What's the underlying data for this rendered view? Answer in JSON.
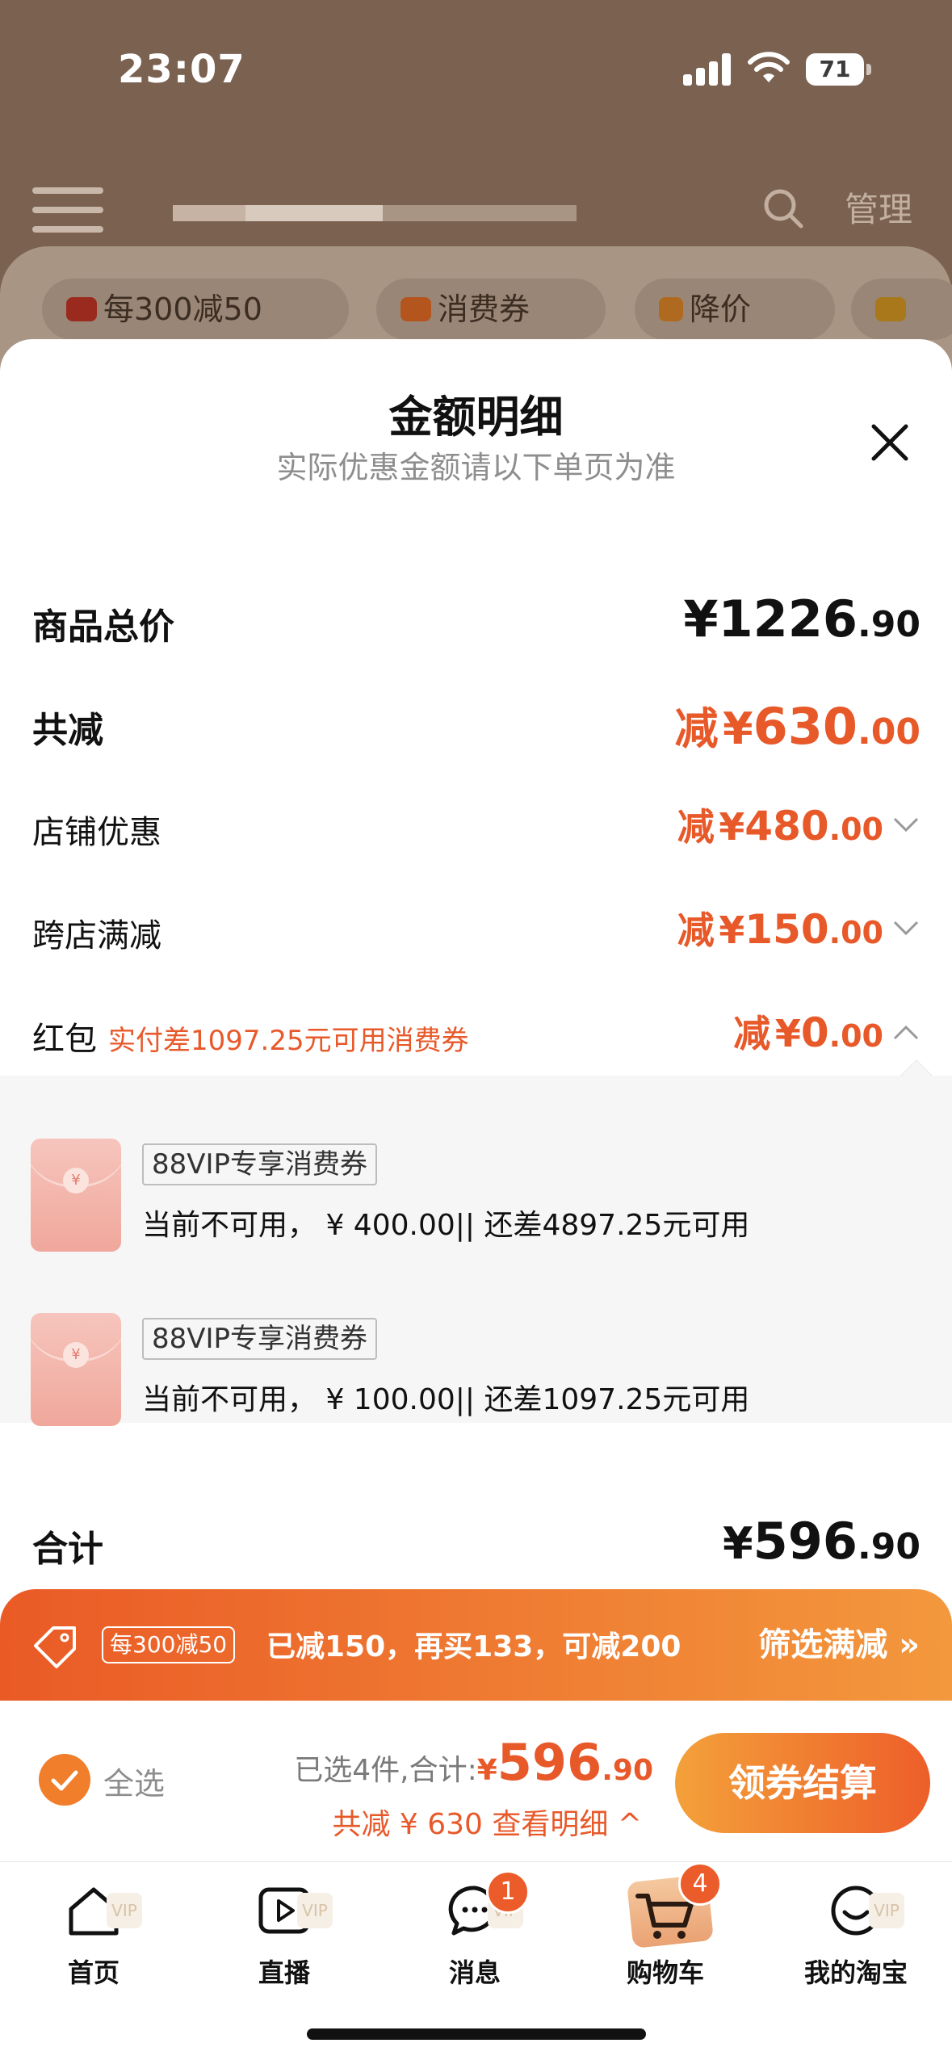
{
  "status_bar": {
    "time": "23:07",
    "battery": "71"
  },
  "background": {
    "manage": "管理",
    "chips": [
      "每300减50",
      "消费券",
      "降价"
    ]
  },
  "sheet": {
    "title": "金额明细",
    "subtitle": "实际优惠金额请以下单页为准",
    "rows": {
      "goods_total": {
        "label": "商品总价",
        "currency": "¥",
        "int": "1226",
        "dec": ".90"
      },
      "total_discount": {
        "label": "共减",
        "prefix": "减",
        "currency": "¥",
        "int": "630",
        "dec": ".00"
      },
      "store_discount": {
        "label": "店铺优惠",
        "prefix": "减",
        "currency": "¥",
        "int": "480",
        "dec": ".00"
      },
      "cross_store": {
        "label": "跨店满减",
        "prefix": "减",
        "currency": "¥",
        "int": "150",
        "dec": ".00"
      },
      "red_packet": {
        "label": "红包",
        "note": "实付差1097.25元可用消费券",
        "prefix": "减",
        "currency": "¥",
        "int": "0",
        "dec": ".00"
      }
    },
    "coupons": [
      {
        "tag": "88VIP专享消费券",
        "desc": "当前不可用， ¥ 400.00|| 还差4897.25元可用",
        "seal": "¥"
      },
      {
        "tag": "88VIP专享消费券",
        "desc": "当前不可用， ¥ 100.00|| 还差1097.25元可用",
        "seal": "¥"
      }
    ],
    "sum": {
      "label": "合计",
      "currency": "¥",
      "int": "596",
      "dec": ".90"
    }
  },
  "promo_bar": {
    "pill": "每300减50",
    "message": "已减150，再买133，可减200",
    "filter": "筛选满减 »"
  },
  "checkout": {
    "select_all": "全选",
    "selected_text": "已选4件,合计:",
    "currency": "¥",
    "int": "596",
    "dec": ".90",
    "discount_text": "共减 ¥ 630  查看明细 ^",
    "button": "领券结算"
  },
  "tabbar": {
    "vip": "VIP",
    "items": [
      {
        "label": "首页",
        "icon": "home-icon"
      },
      {
        "label": "直播",
        "icon": "live-icon"
      },
      {
        "label": "消息",
        "icon": "message-icon",
        "badge": "1"
      },
      {
        "label": "购物车",
        "icon": "cart-icon",
        "badge": "4"
      },
      {
        "label": "我的淘宝",
        "icon": "profile-icon"
      }
    ]
  },
  "colors": {
    "accent": "#e8592a",
    "promo_start": "#ea5a26",
    "promo_end": "#f3983d"
  }
}
